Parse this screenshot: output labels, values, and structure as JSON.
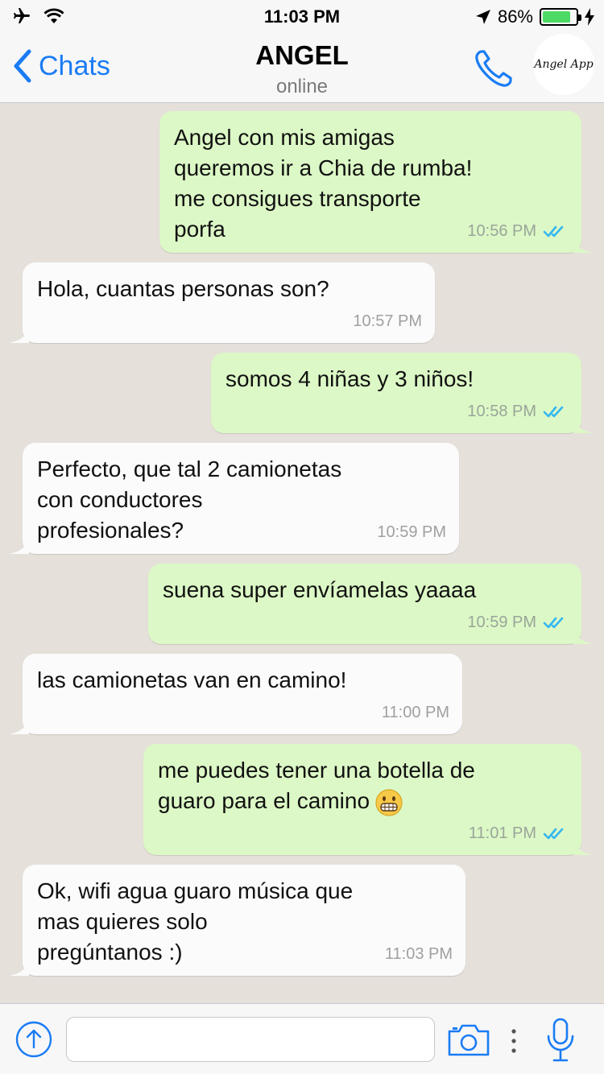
{
  "status": {
    "time": "11:03 PM",
    "battery_percent": "86%",
    "battery_level": 0.86
  },
  "header": {
    "back_label": "Chats",
    "contact_name": "ANGEL",
    "contact_status": "online",
    "avatar_text": "Angel App"
  },
  "messages": [
    {
      "dir": "out",
      "text": "Angel con mis amigas\nqueremos ir a Chia de rumba!\nme consigues transporte\nporfa",
      "time": "10:56 PM"
    },
    {
      "dir": "in",
      "text": "Hola, cuantas personas son?",
      "time": "10:57 PM"
    },
    {
      "dir": "out",
      "text": "somos 4 niñas y 3 niños!",
      "time": "10:58 PM"
    },
    {
      "dir": "in",
      "text": "Perfecto, que tal 2 camionetas\ncon conductores\nprofesionales?",
      "time": "10:59 PM"
    },
    {
      "dir": "out",
      "text": "suena super envíamelas yaaaa",
      "time": "10:59 PM"
    },
    {
      "dir": "in",
      "text": "las camionetas van en camino!",
      "time": "11:00 PM"
    },
    {
      "dir": "out",
      "text": "me puedes tener una botella de\nguaro para el camino",
      "time": "11:01 PM",
      "emoji": "grimacing-face"
    },
    {
      "dir": "in",
      "text": "Ok, wifi agua guaro música que\nmas quieres solo\npregúntanos :)",
      "time": "11:03 PM"
    }
  ],
  "input": {
    "placeholder": ""
  },
  "colors": {
    "accent": "#1a7cf4",
    "outgoing_bubble": "#dcf8c6",
    "incoming_bubble": "#fbfbfb",
    "background": "#e6e0db",
    "read_ticks": "#34b7f1"
  }
}
